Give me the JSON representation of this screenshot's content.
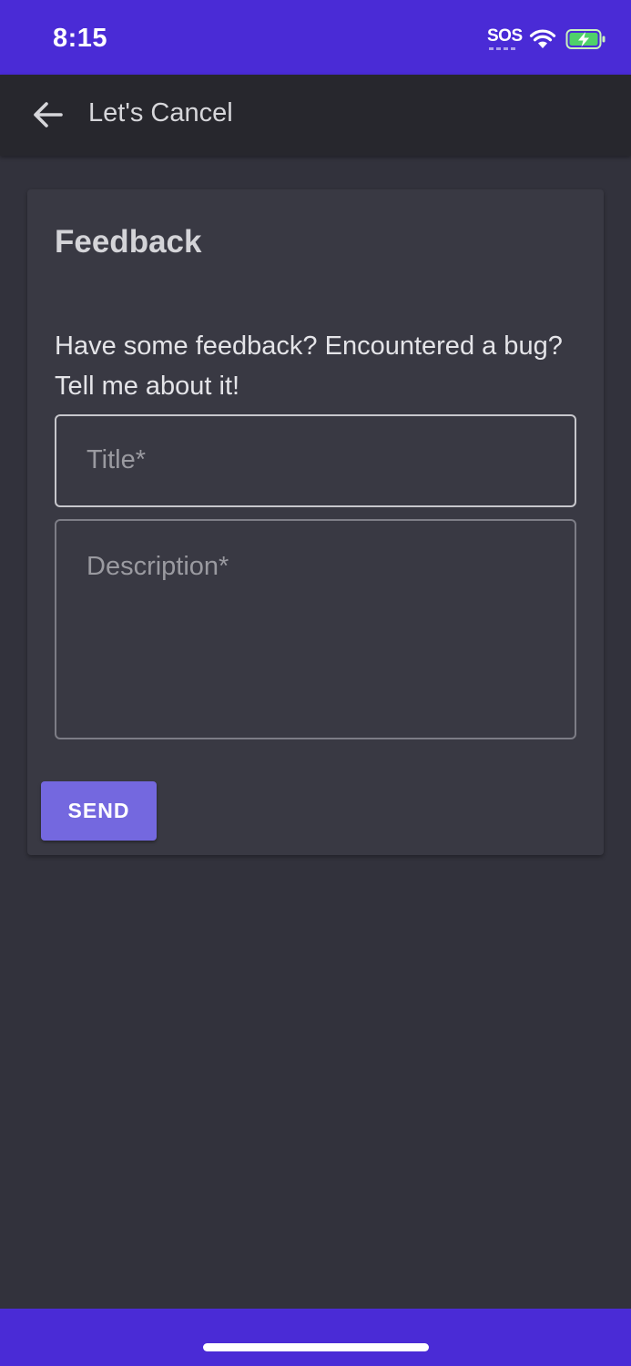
{
  "status_bar": {
    "time": "8:15",
    "sos": "SOS",
    "icons": [
      "sos-icon",
      "wifi-icon",
      "battery-charging-icon"
    ],
    "color": "#4a2bd6"
  },
  "app_bar": {
    "back_icon": "arrow-left-icon",
    "title": "Let's Cancel"
  },
  "feedback": {
    "title": "Feedback",
    "description": "Have some feedback? Encountered a bug? Tell me about it!",
    "title_field": {
      "label": "Title*",
      "value": ""
    },
    "description_field": {
      "label": "Description*",
      "value": ""
    },
    "send_label": "SEND",
    "accent_color": "#7468df"
  },
  "nav_bar": {
    "indicator": "home-indicator",
    "color": "#4a2bd6"
  }
}
